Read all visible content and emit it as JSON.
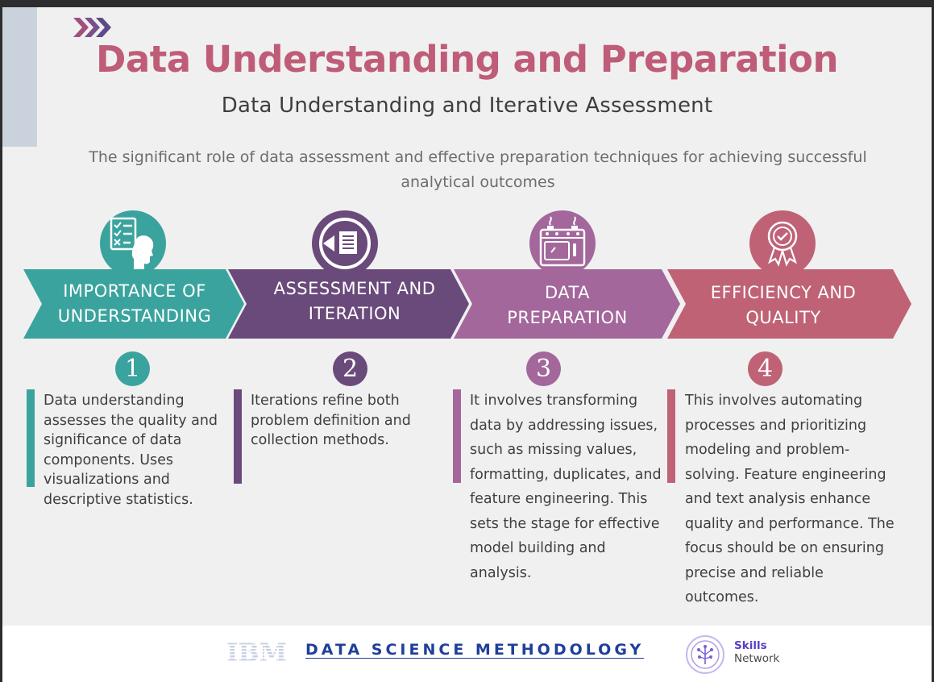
{
  "header": {
    "title": "Data Understanding and Preparation",
    "subtitle": "Data Understanding and Iterative Assessment",
    "tagline": "The significant role of data assessment and effective preparation techniques for achieving successful analytical outcomes"
  },
  "stages": [
    {
      "number": "1",
      "label_line1": "IMPORTANCE OF",
      "label_line2": "UNDERSTANDING",
      "icon": "checklist-head-icon",
      "color": "#3ba39e",
      "description": "Data understanding assesses the quality and significance of data components. Uses visualizations and descriptive statistics."
    },
    {
      "number": "2",
      "label_line1": "ASSESSMENT AND",
      "label_line2": "ITERATION",
      "icon": "document-arrow-icon",
      "color": "#6a4a7b",
      "description": "Iterations refine both problem definition and collection methods."
    },
    {
      "number": "3",
      "label_line1": "DATA",
      "label_line2": "PREPARATION",
      "icon": "kitchen-stove-icon",
      "color": "#a3679b",
      "description": "It involves transforming data by addressing issues, such as missing values, formatting, duplicates, and feature engineering. This sets the stage for effective model building and analysis."
    },
    {
      "number": "4",
      "label_line1": "EFFICIENCY AND",
      "label_line2": "QUALITY",
      "icon": "award-ribbon-icon",
      "color": "#bf6276",
      "description": "This involves automating processes and prioritizing modeling and problem-solving. Feature engineering and text analysis enhance quality and performance. The focus should be on ensuring precise and reliable outcomes."
    }
  ],
  "footer": {
    "ibm_logo": "IBM",
    "methodology": "DATA SCIENCE METHODOLOGY",
    "skills_line1": "Skills",
    "skills_line2": "Network"
  }
}
